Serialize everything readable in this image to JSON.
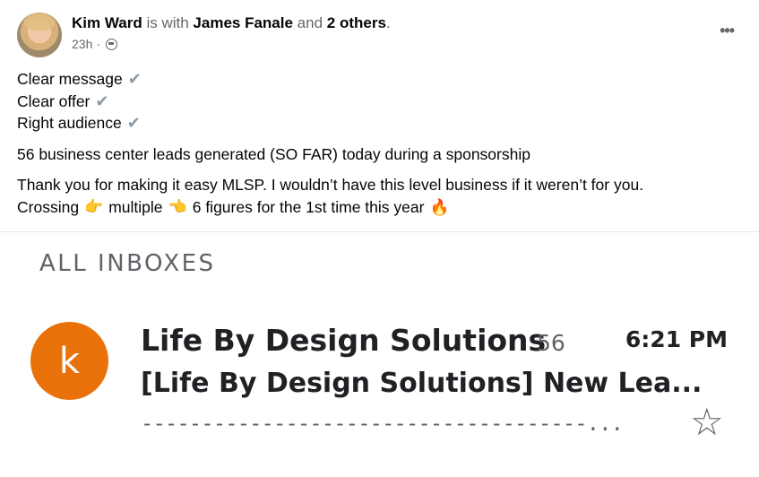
{
  "post": {
    "author": "Kim Ward",
    "with_text": "is with",
    "tagged": "James Fanale",
    "and_text": "and",
    "others": "2 others",
    "period": ".",
    "time": "23h",
    "dot": "·",
    "more_icon": "more-horizontal-icon",
    "lines": {
      "l1": "Clear message",
      "l2": "Clear offer",
      "l3": "Right audience",
      "l4": "56 business center leads generated (SO FAR) today during a sponsorship",
      "l5": "Thank you for making it easy MLSP. I wouldn’t have this level business if it weren’t for you.",
      "l6a": "Crossing",
      "l6b": "multiple",
      "l6c": "6 figures for the 1st time this year"
    },
    "check_glyph": "✔",
    "point_right_glyph": "👉",
    "point_left_glyph": "👈",
    "fire_glyph": "🔥"
  },
  "gmail": {
    "heading": "ALL INBOXES",
    "avatar_letter": "k",
    "avatar_color": "#e8710a",
    "sender": "Life By Design Solutions",
    "count": "56",
    "time": "6:21 PM",
    "subject": "[Life By Design Solutions] New Lea...",
    "snippet": "-------------------------------------...",
    "star_glyph": "☆"
  }
}
